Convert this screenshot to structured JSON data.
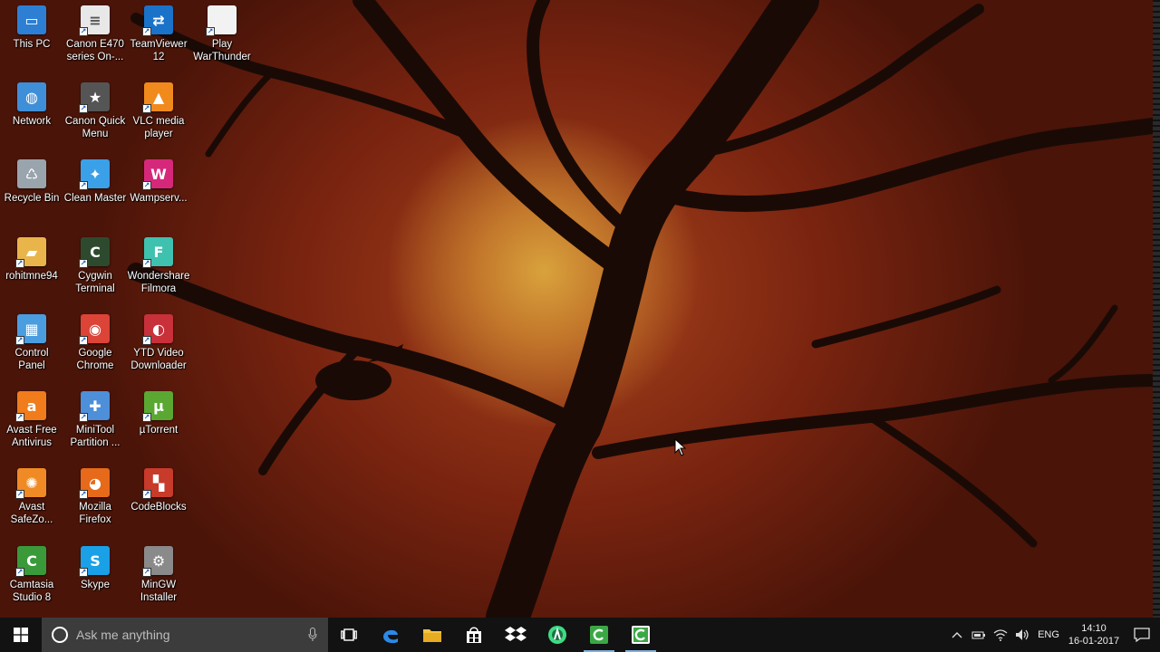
{
  "desktop": {
    "icons": [
      {
        "label": "This PC",
        "icon": "computer-icon",
        "color": "#2d7fd3",
        "glyph": "▭"
      },
      {
        "label": "Canon E470\nseries On-...",
        "icon": "document-icon",
        "color": "#e8e8e8",
        "glyph": "≡"
      },
      {
        "label": "TeamViewer\n12",
        "icon": "teamviewer-icon",
        "color": "#1a73c9",
        "glyph": "⇄"
      },
      {
        "label": "Play\nWarThunder",
        "icon": "blank-file-icon",
        "color": "#f2f2f2",
        "glyph": ""
      },
      {
        "label": "Network",
        "icon": "network-globe-icon",
        "color": "#3f8fd8",
        "glyph": "◍"
      },
      {
        "label": "Canon Quick\nMenu",
        "icon": "canon-menu-icon",
        "color": "#555555",
        "glyph": "★"
      },
      {
        "label": "VLC media\nplayer",
        "icon": "vlc-cone-icon",
        "color": "#f08a1c",
        "glyph": "▲"
      },
      {
        "label": "Recycle Bin",
        "icon": "recycle-bin-icon",
        "color": "#9aa4ad",
        "glyph": "♺"
      },
      {
        "label": "Clean Master",
        "icon": "broom-icon",
        "color": "#3aa0e8",
        "glyph": "✦"
      },
      {
        "label": "Wampserv...",
        "icon": "wampserver-icon",
        "color": "#d6287a",
        "glyph": "W"
      },
      {
        "label": "rohitmne94",
        "icon": "user-folder-icon",
        "color": "#e9b54a",
        "glyph": "▰"
      },
      {
        "label": "Cygwin\nTerminal",
        "icon": "terminal-icon",
        "color": "#2e4a2e",
        "glyph": "C"
      },
      {
        "label": "Wondershare\nFilmora",
        "icon": "filmora-icon",
        "color": "#3fc1b0",
        "glyph": "F"
      },
      {
        "label": "Control\nPanel",
        "icon": "control-panel-icon",
        "color": "#4a9ee0",
        "glyph": "▦"
      },
      {
        "label": "Google\nChrome",
        "icon": "chrome-icon",
        "color": "#db4437",
        "glyph": "◉"
      },
      {
        "label": "YTD Video\nDownloader",
        "icon": "ytd-icon",
        "color": "#c8303a",
        "glyph": "◐"
      },
      {
        "label": "Avast Free\nAntivirus",
        "icon": "avast-icon",
        "color": "#f07c1c",
        "glyph": "a"
      },
      {
        "label": "MiniTool\nPartition ...",
        "icon": "minitool-icon",
        "color": "#4d8fd8",
        "glyph": "✚"
      },
      {
        "label": "µTorrent",
        "icon": "utorrent-icon",
        "color": "#5aa832",
        "glyph": "µ"
      },
      {
        "label": "Avast\nSafeZo...",
        "icon": "avast-safezone-icon",
        "color": "#f08a24",
        "glyph": "✺"
      },
      {
        "label": "Mozilla\nFirefox",
        "icon": "firefox-icon",
        "color": "#e66a1a",
        "glyph": "◕"
      },
      {
        "label": "CodeBlocks",
        "icon": "codeblocks-icon",
        "color": "#c83a2a",
        "glyph": "▚"
      },
      {
        "label": "Camtasia\nStudio 8",
        "icon": "camtasia-icon",
        "color": "#3a9a3a",
        "glyph": "C"
      },
      {
        "label": "Skype",
        "icon": "skype-icon",
        "color": "#1aa0e6",
        "glyph": "S"
      },
      {
        "label": "MinGW\nInstaller",
        "icon": "mingw-installer-icon",
        "color": "#8a8a8a",
        "glyph": "⚙"
      }
    ]
  },
  "taskbar": {
    "search_placeholder": "Ask me anything",
    "pinned": [
      {
        "icon": "task-view-icon"
      },
      {
        "icon": "edge-icon"
      },
      {
        "icon": "file-explorer-icon"
      },
      {
        "icon": "store-icon"
      },
      {
        "icon": "dropbox-icon"
      },
      {
        "icon": "android-studio-icon"
      },
      {
        "icon": "camtasia-icon"
      },
      {
        "icon": "camtasia-recorder-icon"
      }
    ],
    "tray": {
      "language": "ENG",
      "time": "14:10",
      "date": "16-01-2017"
    }
  }
}
